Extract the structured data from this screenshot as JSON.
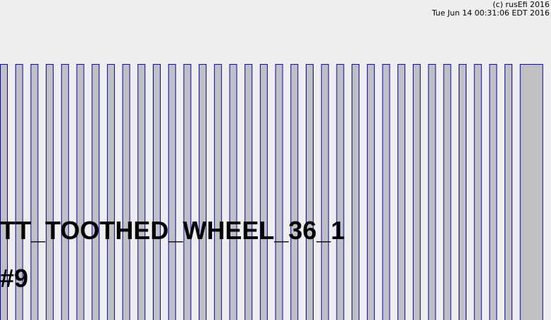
{
  "header": {
    "copyright": "(c) rusEfi 2016",
    "timestamp": "Tue Jun 14 00:31:06 EDT 2016"
  },
  "trigger": {
    "name": "TT_TOOTHED_WHEEL_36_1",
    "index": "#9",
    "total_teeth": 36,
    "missing_teeth": 1
  },
  "colors": {
    "background": "#eeeeee",
    "tooth_fill": "#c0c0c0",
    "tooth_stroke": "#0000cc"
  }
}
